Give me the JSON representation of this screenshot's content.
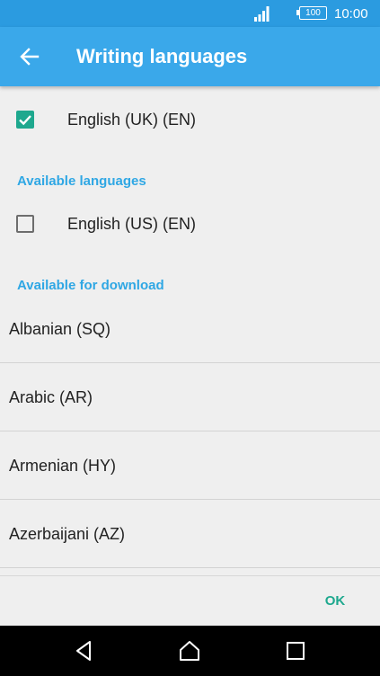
{
  "status_bar": {
    "battery_level": "100",
    "time": "10:00",
    "signal_icon": "signal-icon",
    "battery_icon": "battery-icon"
  },
  "app_bar": {
    "title": "Writing languages",
    "back_icon": "arrow-left-icon",
    "background_color": "#3aa8ea"
  },
  "enabled_languages": [
    {
      "label": "English (UK) (EN)",
      "checked": true
    }
  ],
  "available_languages": {
    "header": "Available languages",
    "items": [
      {
        "label": "English (US) (EN)",
        "checked": false
      }
    ]
  },
  "download": {
    "header": "Available for download",
    "items": [
      {
        "label": "Albanian (SQ)"
      },
      {
        "label": "Arabic (AR)"
      },
      {
        "label": "Armenian (HY)"
      },
      {
        "label": "Azerbaijani (AZ)"
      }
    ]
  },
  "footer": {
    "ok_label": "OK"
  },
  "nav_bar": {
    "back_icon": "triangle-back-icon",
    "home_icon": "home-icon",
    "recents_icon": "square-recents-icon"
  },
  "colors": {
    "accent": "#1ea88e",
    "section_header": "#2fa7e4",
    "status_bar": "#2b9be0"
  }
}
